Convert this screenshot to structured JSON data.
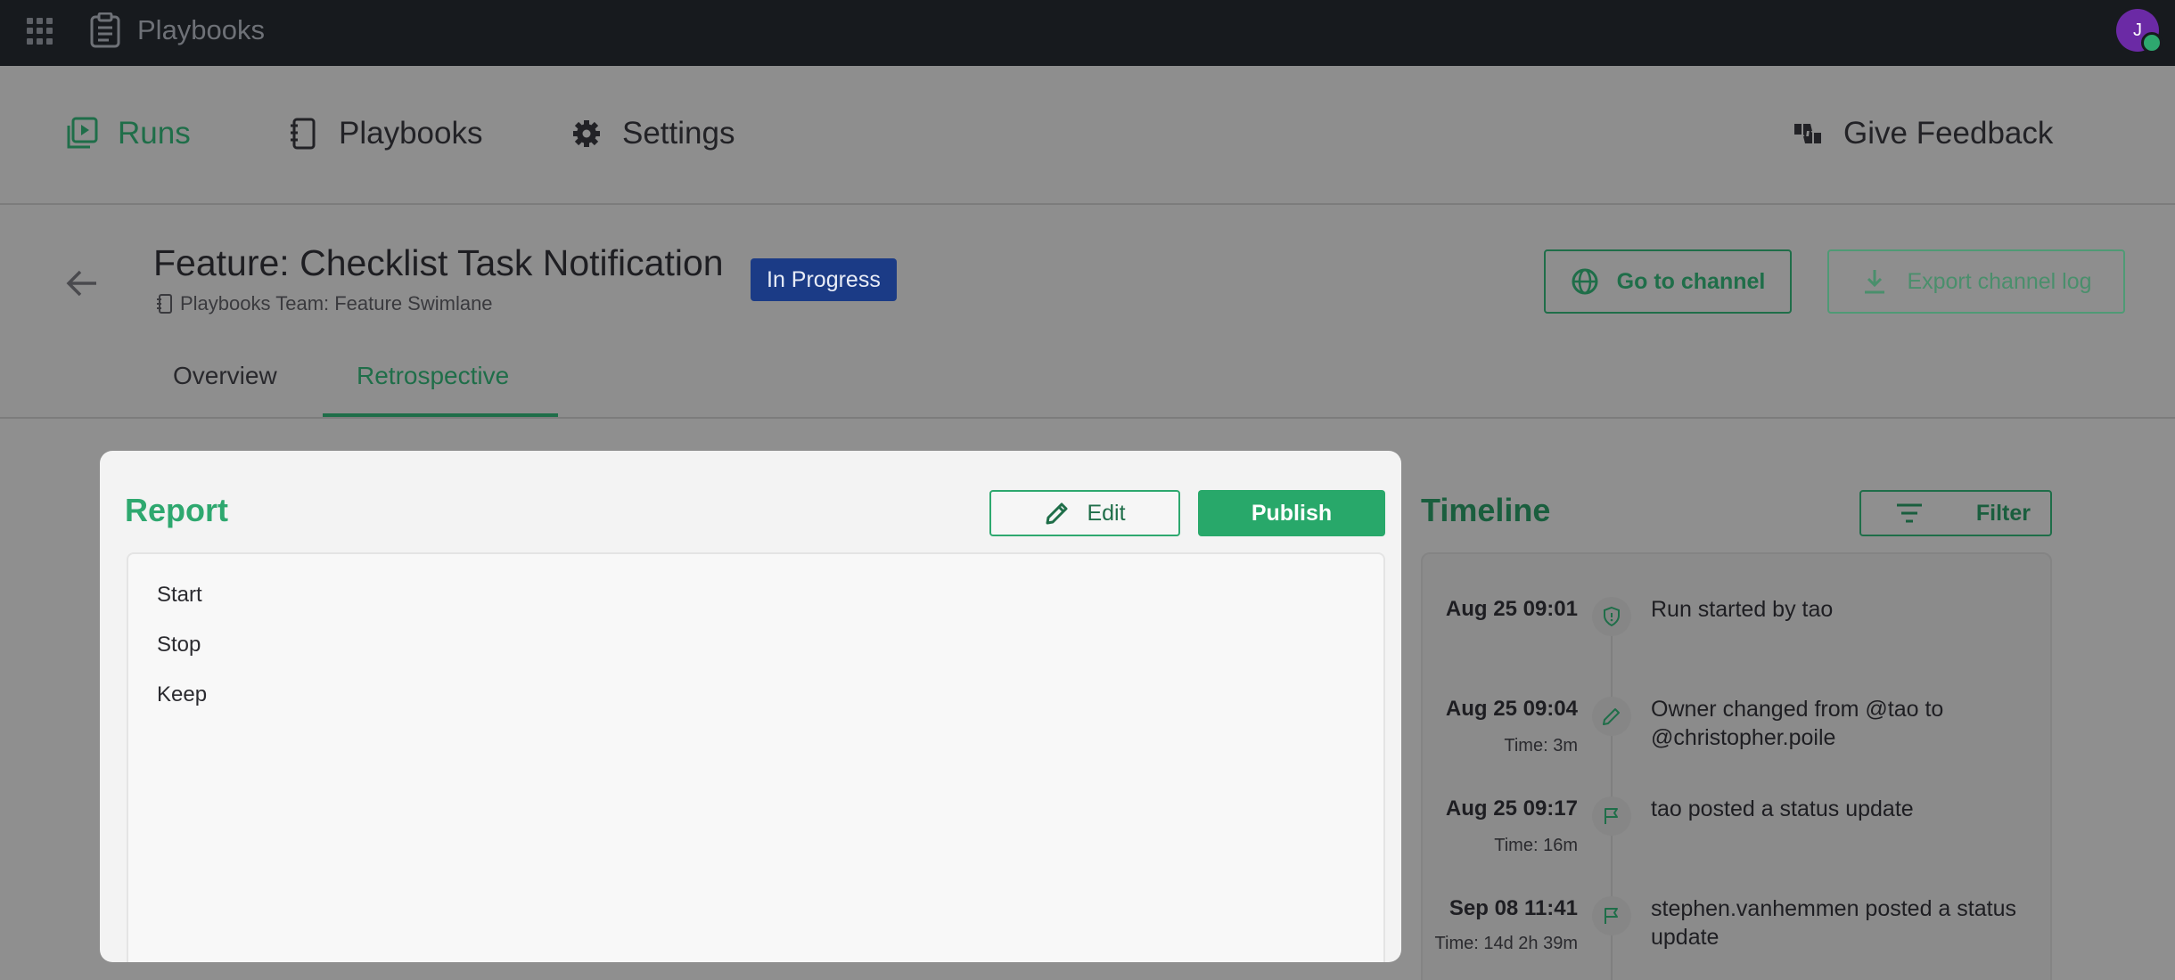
{
  "topbar": {
    "app_name": "Playbooks",
    "avatar_initial": "J"
  },
  "nav": {
    "runs": "Runs",
    "playbooks": "Playbooks",
    "settings": "Settings",
    "feedback": "Give Feedback"
  },
  "run": {
    "title": "Feature: Checklist Task Notification",
    "subtitle": "Playbooks Team: Feature Swimlane",
    "status": "In Progress",
    "go_to_channel": "Go to channel",
    "export_log": "Export channel log"
  },
  "tabs": {
    "overview": "Overview",
    "retrospective": "Retrospective"
  },
  "report": {
    "title": "Report",
    "edit_label": "Edit",
    "publish_label": "Publish",
    "lines": [
      "Start",
      "Stop",
      "Keep"
    ]
  },
  "timeline": {
    "title": "Timeline",
    "filter_label": "Filter",
    "events": [
      {
        "date": "Aug 25 09:01",
        "time": "",
        "text": "Run started by tao",
        "icon": "shield-icon"
      },
      {
        "date": "Aug 25 09:04",
        "time": "Time: 3m",
        "text": "Owner changed from @tao to @christopher.poile",
        "icon": "pencil-icon"
      },
      {
        "date": "Aug 25 09:17",
        "time": "Time: 16m",
        "text": "tao posted a status update",
        "icon": "flag-icon"
      },
      {
        "date": "Sep 08 11:41",
        "time": "Time: 14d 2h 39m",
        "text": "stephen.vanhemmen posted a status update",
        "icon": "flag-icon"
      }
    ]
  },
  "colors": {
    "accent": "#2ea86f",
    "accent_dark": "#1f6e49",
    "badge": "#1b3b86",
    "topbar": "#171a1e"
  }
}
